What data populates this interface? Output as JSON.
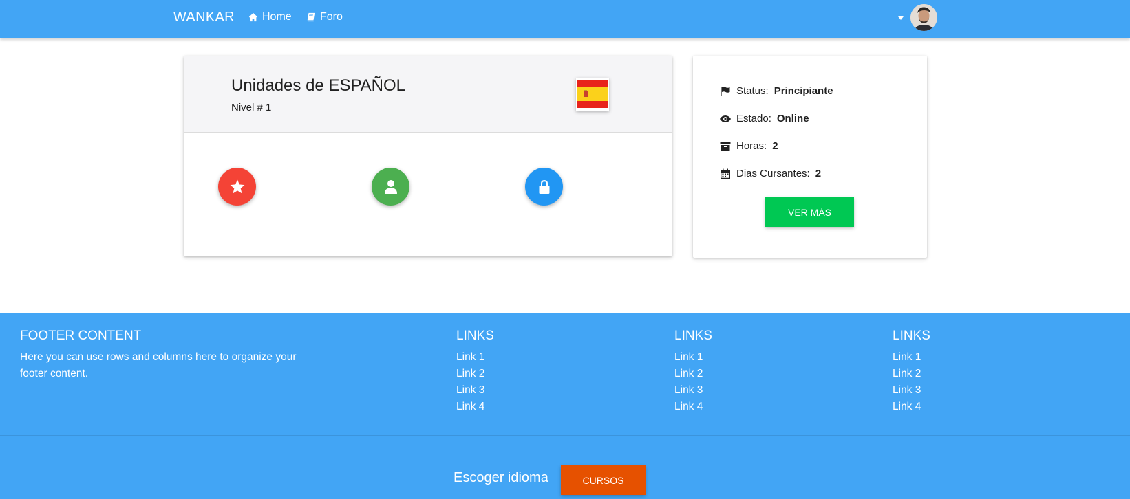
{
  "navbar": {
    "brand": "WANKAR",
    "links": [
      {
        "label": "Home",
        "icon": "home-icon"
      },
      {
        "label": "Foro",
        "icon": "book-icon"
      }
    ],
    "user_menu_icon": "caret-down-icon"
  },
  "unit_card": {
    "title": "Unidades de ESPAÑOL",
    "subtitle": "Nivel # 1",
    "flag_icon": "spain-flag-icon",
    "actions": [
      {
        "icon": "star-icon",
        "color": "#f44336"
      },
      {
        "icon": "user-icon",
        "color": "#4caf50"
      },
      {
        "icon": "lock-icon",
        "color": "#2196f3"
      }
    ]
  },
  "stats_card": {
    "stats": [
      {
        "icon": "flag-icon",
        "label": "Status:",
        "value": "Principiante"
      },
      {
        "icon": "eye-icon",
        "label": "Estado:",
        "value": "Online"
      },
      {
        "icon": "archive-icon",
        "label": "Horas:",
        "value": "2"
      },
      {
        "icon": "calendar-icon",
        "label": "Dias Cursantes:",
        "value": "2"
      }
    ],
    "button_label": "VER MÁS",
    "button_color": "#00c853"
  },
  "footer": {
    "title": "FOOTER CONTENT",
    "text": "Here you can use rows and columns here to organize your footer content.",
    "columns": [
      {
        "title": "LINKS",
        "links": [
          "Link 1",
          "Link 2",
          "Link 3",
          "Link 4"
        ]
      },
      {
        "title": "LINKS",
        "links": [
          "Link 1",
          "Link 2",
          "Link 3",
          "Link 4"
        ]
      },
      {
        "title": "LINKS",
        "links": [
          "Link 1",
          "Link 2",
          "Link 3",
          "Link 4"
        ]
      }
    ],
    "language_label": "Escoger idioma",
    "courses_button": "CURSOS",
    "courses_button_color": "#e65100"
  },
  "colors": {
    "primary": "#42a5f5"
  }
}
